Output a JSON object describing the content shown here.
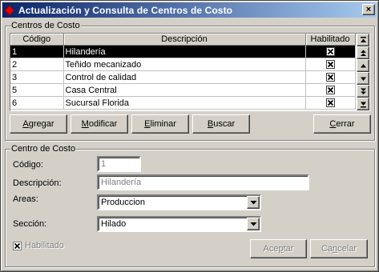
{
  "window": {
    "title": "Actualización y Consulta de Centros de Costo",
    "close_symbol": "×",
    "icon": "red-diamond-icon"
  },
  "list_group": {
    "title": "Centros de Costo",
    "columns": [
      "Código",
      "Descripción",
      "Habilitado"
    ],
    "rows": [
      {
        "codigo": "1",
        "descripcion": "Hilandería",
        "habilitado": true,
        "selected": true
      },
      {
        "codigo": "2",
        "descripcion": "Teñido mecanizado",
        "habilitado": true,
        "selected": false
      },
      {
        "codigo": "3",
        "descripcion": "Control de calidad",
        "habilitado": true,
        "selected": false
      },
      {
        "codigo": "5",
        "descripcion": "Casa Central",
        "habilitado": true,
        "selected": false
      },
      {
        "codigo": "6",
        "descripcion": "Sucursal Florida",
        "habilitado": true,
        "selected": false
      }
    ]
  },
  "buttons": {
    "agregar": {
      "accel": "A",
      "rest": "gregar"
    },
    "modificar": {
      "accel": "M",
      "rest": "odificar"
    },
    "eliminar": {
      "accel": "E",
      "rest": "liminar"
    },
    "buscar": {
      "accel": "B",
      "rest": "uscar"
    },
    "cerrar": {
      "accel": "C",
      "rest": "errar"
    },
    "aceptar": {
      "pre": "Ace",
      "accel": "p",
      "rest": "tar"
    },
    "cancelar": {
      "pre": "Ca",
      "accel": "n",
      "rest": "celar"
    }
  },
  "detail_group": {
    "title": "Centro de Costo",
    "codigo_label": "Código:",
    "codigo_value": "1",
    "descripcion_label": "Descripción:",
    "descripcion_value": "Hilandería",
    "areas_label": "Areas:",
    "areas_value": "Produccion",
    "seccion_label": "Sección:",
    "seccion_value": "Hilado",
    "habilitado_label": "Habilitado",
    "habilitado_checked": true
  },
  "colors": {
    "title_gradient_start": "#0a246a",
    "title_gradient_end": "#a6caf0",
    "selected_row": "#000000",
    "face": "#d4d0c8"
  }
}
